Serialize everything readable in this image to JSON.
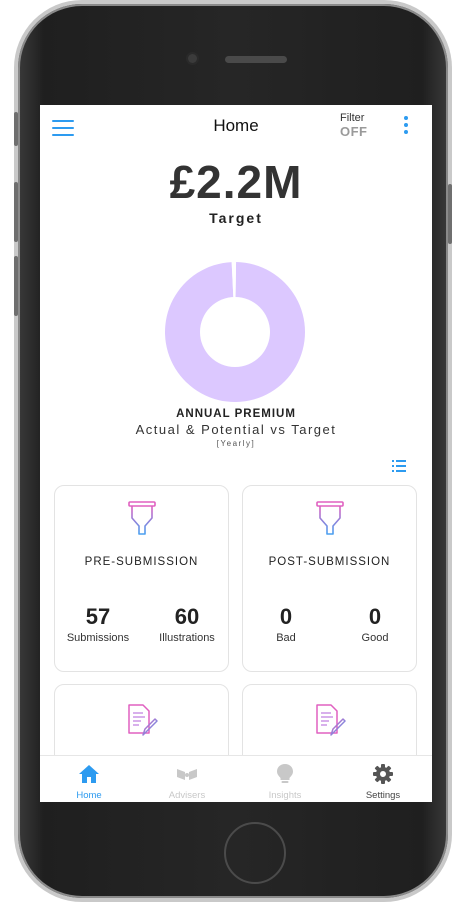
{
  "header": {
    "title": "Home",
    "filter_label": "Filter",
    "filter_value": "OFF"
  },
  "summary": {
    "value": "£2.2M",
    "label": "Target"
  },
  "chart_data": {
    "type": "pie",
    "title": "ANNUAL PREMIUM",
    "subtitle": "Actual & Potential vs Target",
    "period": "[Yearly]",
    "values": [
      99,
      1
    ],
    "colors": [
      "#dcc8ff",
      "#ffffff"
    ]
  },
  "cards": [
    {
      "title": "PRE-SUBMISSION",
      "stats": [
        {
          "value": "57",
          "label": "Submissions"
        },
        {
          "value": "60",
          "label": "Illustrations"
        }
      ]
    },
    {
      "title": "POST-SUBMISSION",
      "stats": [
        {
          "value": "0",
          "label": "Bad"
        },
        {
          "value": "0",
          "label": "Good"
        }
      ]
    }
  ],
  "tabs": [
    {
      "label": "Home",
      "icon": "home-icon",
      "active": true
    },
    {
      "label": "Advisers",
      "icon": "advisers-icon",
      "active": false
    },
    {
      "label": "Insights",
      "icon": "lightbulb-icon",
      "active": false
    },
    {
      "label": "Settings",
      "icon": "gear-icon",
      "active": false
    }
  ],
  "colors": {
    "accent": "#2d9bf0",
    "donut": "#dcc8ff",
    "funnel_pink": "#e060c0",
    "funnel_blue": "#4aa0f0",
    "inactive": "#c8c8c8"
  }
}
